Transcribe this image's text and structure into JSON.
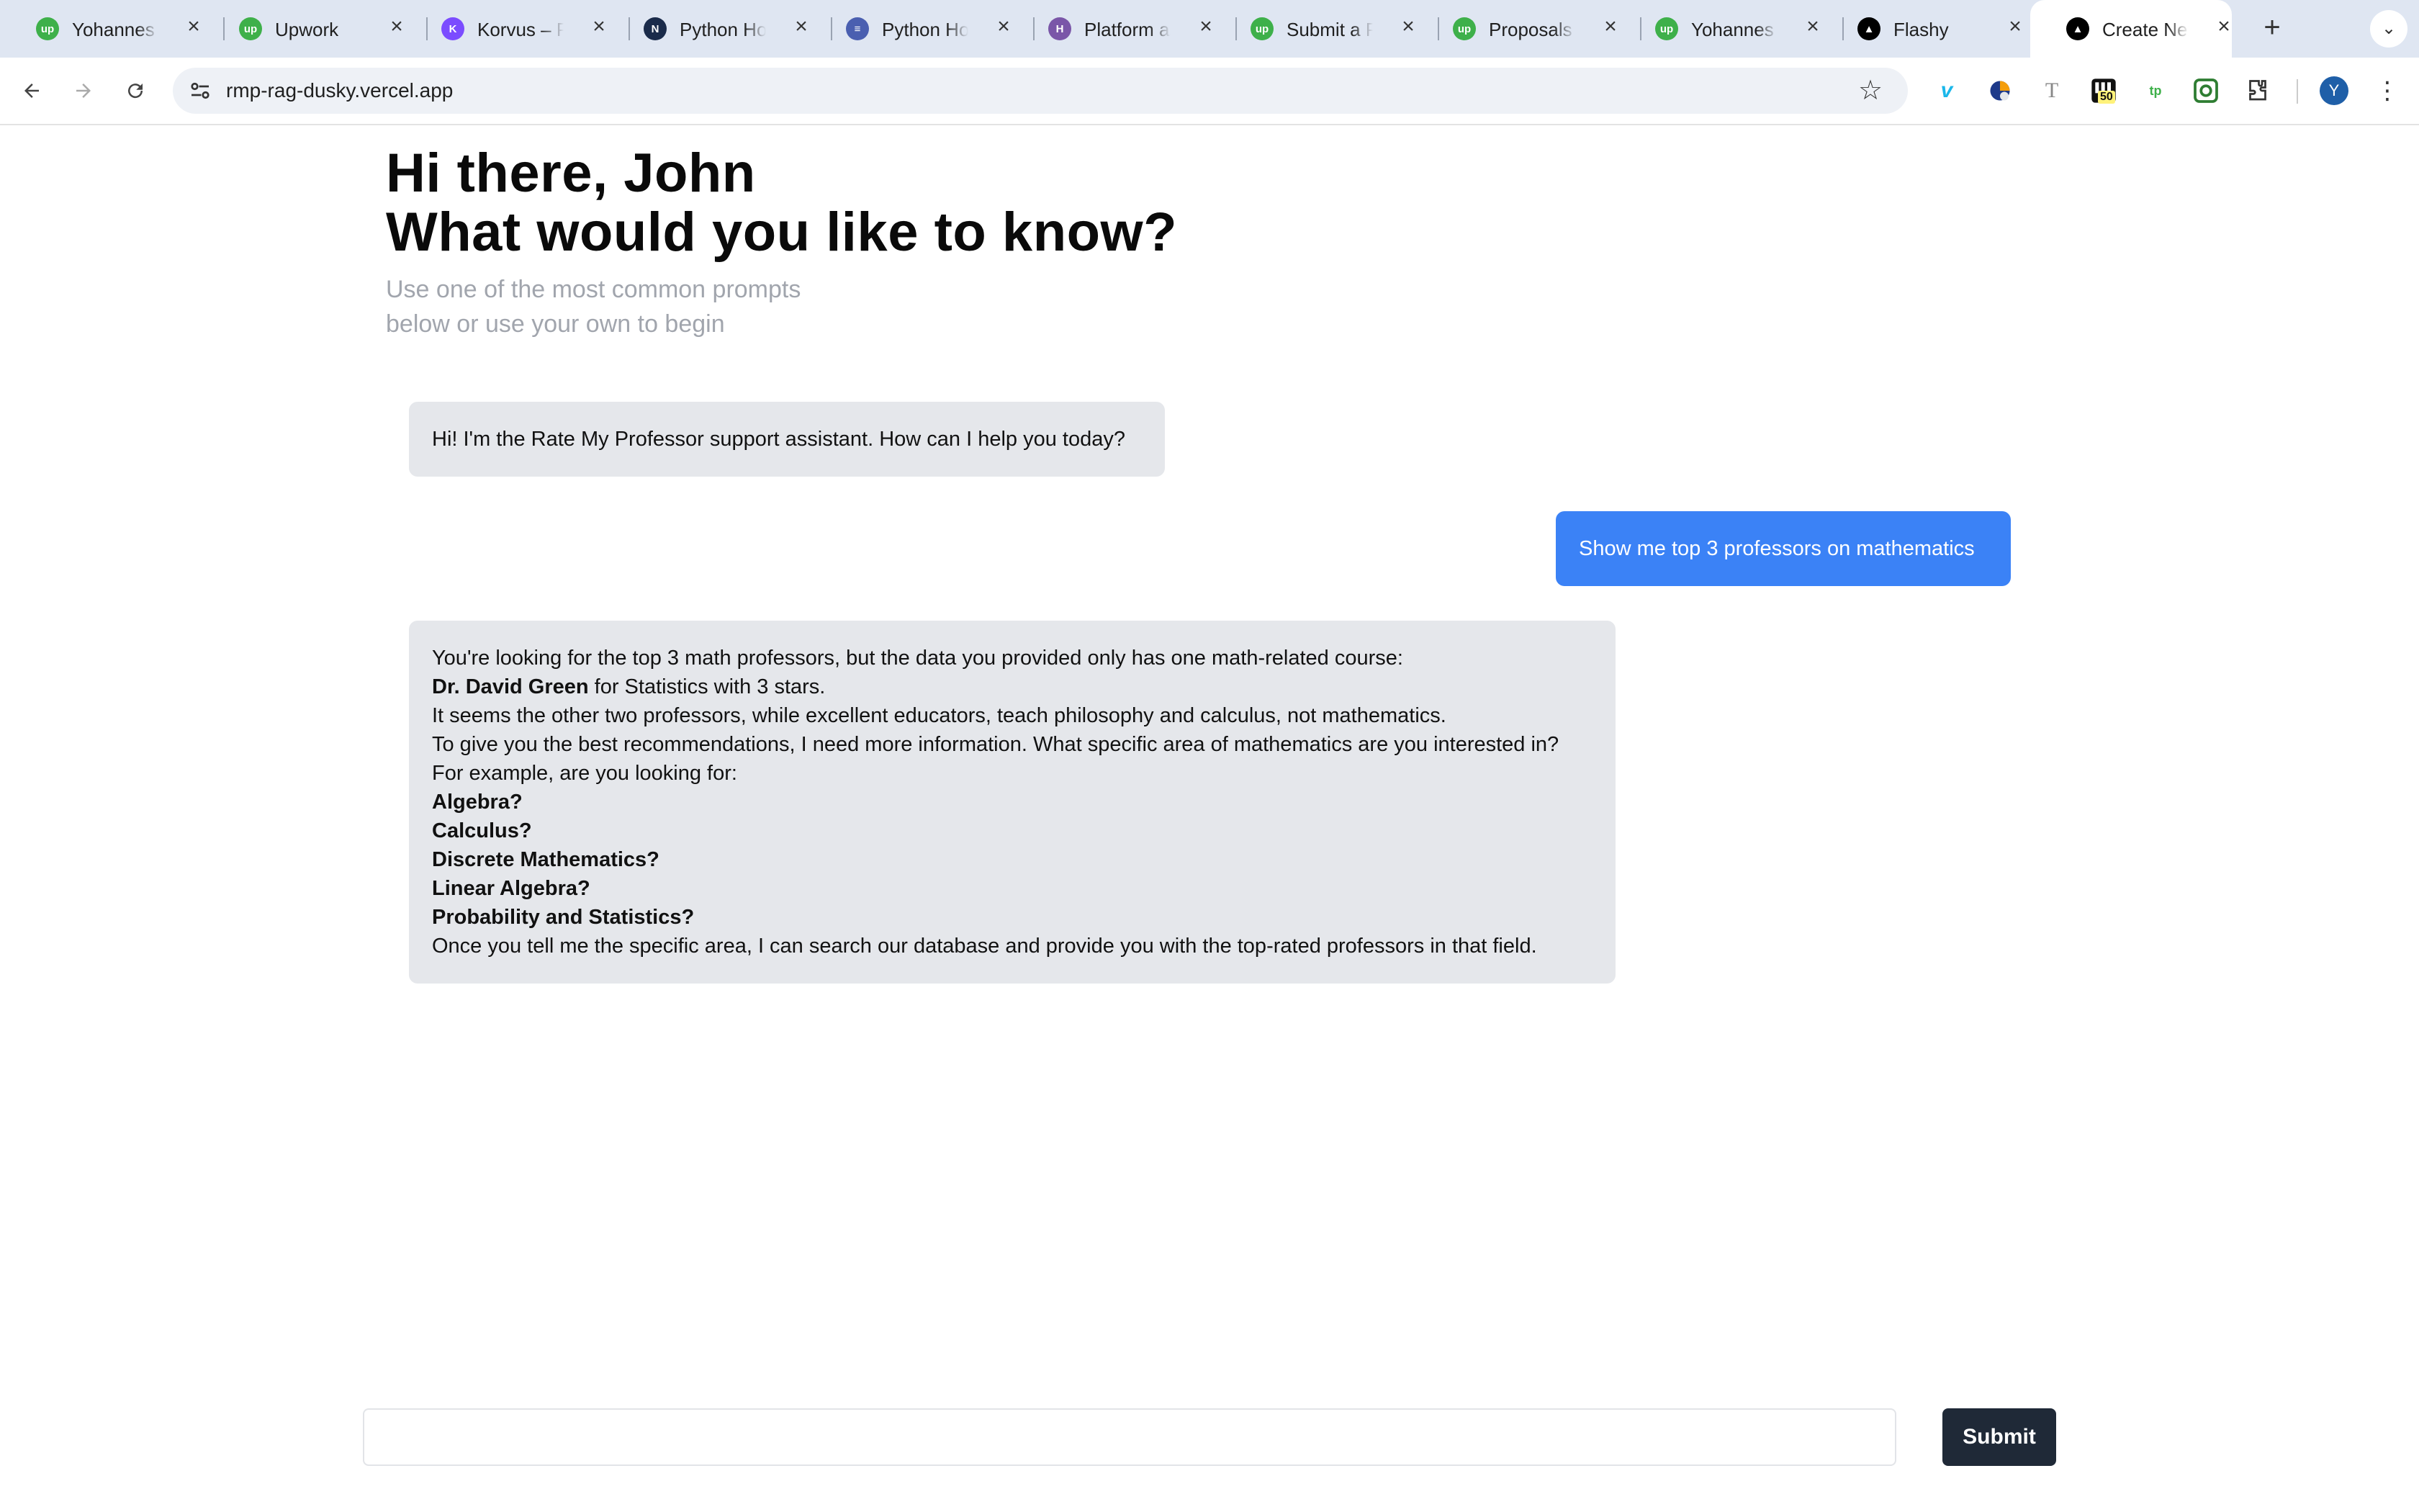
{
  "browser": {
    "tabs": [
      {
        "title": "Yohannes K",
        "icon": "upwork-icon",
        "color": "#3eb04a",
        "glyph": "up"
      },
      {
        "title": "Upwork",
        "icon": "upwork-icon",
        "color": "#3eb04a",
        "glyph": "up"
      },
      {
        "title": "Korvus – Po",
        "icon": "korvus-icon",
        "color": "#7b4cff",
        "glyph": "K"
      },
      {
        "title": "Python Host",
        "icon": "hosting-icon",
        "color": "#1a2b4a",
        "glyph": "N"
      },
      {
        "title": "Python Host",
        "icon": "database-icon",
        "color": "#4a5fb0",
        "glyph": "≡"
      },
      {
        "title": "Platform as",
        "icon": "heroku-icon",
        "color": "#7a56a8",
        "glyph": "H"
      },
      {
        "title": "Submit a Pr",
        "icon": "upwork-icon",
        "color": "#3eb04a",
        "glyph": "up"
      },
      {
        "title": "Proposals",
        "icon": "upwork-icon",
        "color": "#3eb04a",
        "glyph": "up"
      },
      {
        "title": "Yohannes K",
        "icon": "upwork-icon",
        "color": "#3eb04a",
        "glyph": "up"
      },
      {
        "title": "Flashy",
        "icon": "vercel-icon",
        "color": "#000000",
        "glyph": "▲"
      },
      {
        "title": "Create Next",
        "icon": "vercel-icon",
        "color": "#000000",
        "glyph": "▲"
      }
    ],
    "url": "rmp-rag-dusky.vercel.app",
    "extension_badge": "50",
    "profile_initial": "Y"
  },
  "page": {
    "greeting": "Hi there, John",
    "question": "What would you like to know?",
    "subtitle_line1": "Use one of the most common prompts",
    "subtitle_line2": "below or use your own to begin"
  },
  "messages": {
    "assistant_intro": "Hi! I'm the Rate My Professor support assistant. How can I help you today?",
    "user_query": "Show me top 3 professors on mathematics",
    "reply": {
      "l1": "You're looking for the top 3 math professors, but the data you provided only has one math-related course:",
      "l2_bold": "Dr. David Green",
      "l2_rest": " for Statistics with 3 stars.",
      "l3": "It seems the other two professors, while excellent educators, teach philosophy and calculus, not mathematics.",
      "l4": "To give you the best recommendations, I need more information. What specific area of mathematics are you interested in?",
      "l5": "For example, are you looking for:",
      "opt1": "Algebra?",
      "opt2": "Calculus?",
      "opt3": "Discrete Mathematics?",
      "opt4": "Linear Algebra?",
      "opt5": "Probability and Statistics?",
      "l6": "Once you tell me the specific area, I can search our database and provide you with the top-rated professors in that field."
    }
  },
  "composer": {
    "value": "",
    "submit_label": "Submit"
  }
}
